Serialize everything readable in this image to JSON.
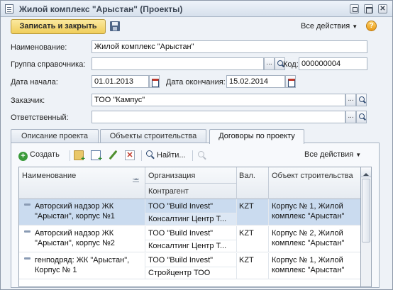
{
  "window": {
    "title": "Жилой комплекс \"Арыстан\" (Проекты)"
  },
  "toolbar": {
    "save_close_label": "Записать и закрыть",
    "all_actions_label": "Все действия",
    "help_label": "?"
  },
  "form": {
    "name_label": "Наименование:",
    "name_value": "Жилой комплекс \"Арыстан\"",
    "group_label": "Группа справочника:",
    "group_value": "",
    "code_label": "Код:",
    "code_value": "000000004",
    "start_label": "Дата начала:",
    "start_value": "01.01.2013",
    "end_label": "Дата окончания:",
    "end_value": "15.02.2014",
    "customer_label": "Заказчик:",
    "customer_value": "ТОО \"Кампус\"",
    "responsible_label": "Ответственный:",
    "responsible_value": "",
    "select_glyph": "..."
  },
  "tabs": [
    {
      "label": "Описание проекта"
    },
    {
      "label": "Объекты строительства"
    },
    {
      "label": "Договоры по проекту"
    }
  ],
  "contracts": {
    "create_label": "Создать",
    "find_label": "Найти...",
    "all_actions_label": "Все действия",
    "headers": {
      "name": "Наименование",
      "org": "Организация",
      "counterparty": "Контрагент",
      "currency": "Вал.",
      "object": "Объект строительства"
    },
    "rows": [
      {
        "name_line1": "Авторский надзор ЖК",
        "name_line2": "\"Арыстан\", корпус №1",
        "org": "ТОО \"Build Invest\"",
        "counterparty": "Консалтинг Центр Т...",
        "currency": "KZT",
        "object_line1": "Корпус № 1, Жилой",
        "object_line2": "комплекс \"Арыстан\""
      },
      {
        "name_line1": "Авторский надзор ЖК",
        "name_line2": "\"Арыстан\", корпус №2",
        "org": "ТОО \"Build Invest\"",
        "counterparty": "Консалтинг Центр Т...",
        "currency": "KZT",
        "object_line1": "Корпус № 2, Жилой",
        "object_line2": "комплекс \"Арыстан\""
      },
      {
        "name_line1": "генподряд: ЖК \"Арыстан\",",
        "name_line2": "Корпус № 1",
        "org": "ТОО \"Build Invest\"",
        "counterparty": "Стройцентр ТОО",
        "currency": "KZT",
        "object_line1": "Корпус № 1, Жилой",
        "object_line2": "комплекс \"Арыстан\""
      }
    ]
  }
}
